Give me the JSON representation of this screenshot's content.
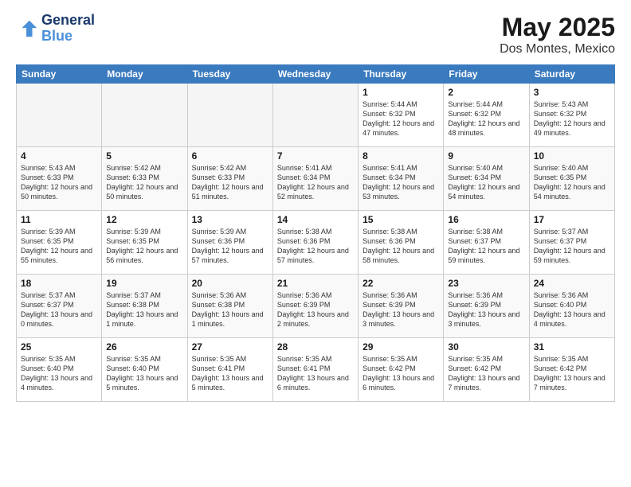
{
  "header": {
    "logo_line1": "General",
    "logo_line2": "Blue",
    "title": "May 2025",
    "subtitle": "Dos Montes, Mexico"
  },
  "weekdays": [
    "Sunday",
    "Monday",
    "Tuesday",
    "Wednesday",
    "Thursday",
    "Friday",
    "Saturday"
  ],
  "rows": [
    {
      "cells": [
        {
          "empty": true
        },
        {
          "empty": true
        },
        {
          "empty": true
        },
        {
          "empty": true
        },
        {
          "day": 1,
          "sunrise": "5:44 AM",
          "sunset": "6:32 PM",
          "daylight": "12 hours and 47 minutes."
        },
        {
          "day": 2,
          "sunrise": "5:44 AM",
          "sunset": "6:32 PM",
          "daylight": "12 hours and 48 minutes."
        },
        {
          "day": 3,
          "sunrise": "5:43 AM",
          "sunset": "6:32 PM",
          "daylight": "12 hours and 49 minutes."
        }
      ]
    },
    {
      "cells": [
        {
          "day": 4,
          "sunrise": "5:43 AM",
          "sunset": "6:33 PM",
          "daylight": "12 hours and 50 minutes."
        },
        {
          "day": 5,
          "sunrise": "5:42 AM",
          "sunset": "6:33 PM",
          "daylight": "12 hours and 50 minutes."
        },
        {
          "day": 6,
          "sunrise": "5:42 AM",
          "sunset": "6:33 PM",
          "daylight": "12 hours and 51 minutes."
        },
        {
          "day": 7,
          "sunrise": "5:41 AM",
          "sunset": "6:34 PM",
          "daylight": "12 hours and 52 minutes."
        },
        {
          "day": 8,
          "sunrise": "5:41 AM",
          "sunset": "6:34 PM",
          "daylight": "12 hours and 53 minutes."
        },
        {
          "day": 9,
          "sunrise": "5:40 AM",
          "sunset": "6:34 PM",
          "daylight": "12 hours and 54 minutes."
        },
        {
          "day": 10,
          "sunrise": "5:40 AM",
          "sunset": "6:35 PM",
          "daylight": "12 hours and 54 minutes."
        }
      ]
    },
    {
      "cells": [
        {
          "day": 11,
          "sunrise": "5:39 AM",
          "sunset": "6:35 PM",
          "daylight": "12 hours and 55 minutes."
        },
        {
          "day": 12,
          "sunrise": "5:39 AM",
          "sunset": "6:35 PM",
          "daylight": "12 hours and 56 minutes."
        },
        {
          "day": 13,
          "sunrise": "5:39 AM",
          "sunset": "6:36 PM",
          "daylight": "12 hours and 57 minutes."
        },
        {
          "day": 14,
          "sunrise": "5:38 AM",
          "sunset": "6:36 PM",
          "daylight": "12 hours and 57 minutes."
        },
        {
          "day": 15,
          "sunrise": "5:38 AM",
          "sunset": "6:36 PM",
          "daylight": "12 hours and 58 minutes."
        },
        {
          "day": 16,
          "sunrise": "5:38 AM",
          "sunset": "6:37 PM",
          "daylight": "12 hours and 59 minutes."
        },
        {
          "day": 17,
          "sunrise": "5:37 AM",
          "sunset": "6:37 PM",
          "daylight": "12 hours and 59 minutes."
        }
      ]
    },
    {
      "cells": [
        {
          "day": 18,
          "sunrise": "5:37 AM",
          "sunset": "6:37 PM",
          "daylight": "13 hours and 0 minutes."
        },
        {
          "day": 19,
          "sunrise": "5:37 AM",
          "sunset": "6:38 PM",
          "daylight": "13 hours and 1 minute."
        },
        {
          "day": 20,
          "sunrise": "5:36 AM",
          "sunset": "6:38 PM",
          "daylight": "13 hours and 1 minutes."
        },
        {
          "day": 21,
          "sunrise": "5:36 AM",
          "sunset": "6:39 PM",
          "daylight": "13 hours and 2 minutes."
        },
        {
          "day": 22,
          "sunrise": "5:36 AM",
          "sunset": "6:39 PM",
          "daylight": "13 hours and 3 minutes."
        },
        {
          "day": 23,
          "sunrise": "5:36 AM",
          "sunset": "6:39 PM",
          "daylight": "13 hours and 3 minutes."
        },
        {
          "day": 24,
          "sunrise": "5:36 AM",
          "sunset": "6:40 PM",
          "daylight": "13 hours and 4 minutes."
        }
      ]
    },
    {
      "cells": [
        {
          "day": 25,
          "sunrise": "5:35 AM",
          "sunset": "6:40 PM",
          "daylight": "13 hours and 4 minutes."
        },
        {
          "day": 26,
          "sunrise": "5:35 AM",
          "sunset": "6:40 PM",
          "daylight": "13 hours and 5 minutes."
        },
        {
          "day": 27,
          "sunrise": "5:35 AM",
          "sunset": "6:41 PM",
          "daylight": "13 hours and 5 minutes."
        },
        {
          "day": 28,
          "sunrise": "5:35 AM",
          "sunset": "6:41 PM",
          "daylight": "13 hours and 6 minutes."
        },
        {
          "day": 29,
          "sunrise": "5:35 AM",
          "sunset": "6:42 PM",
          "daylight": "13 hours and 6 minutes."
        },
        {
          "day": 30,
          "sunrise": "5:35 AM",
          "sunset": "6:42 PM",
          "daylight": "13 hours and 7 minutes."
        },
        {
          "day": 31,
          "sunrise": "5:35 AM",
          "sunset": "6:42 PM",
          "daylight": "13 hours and 7 minutes."
        }
      ]
    }
  ]
}
